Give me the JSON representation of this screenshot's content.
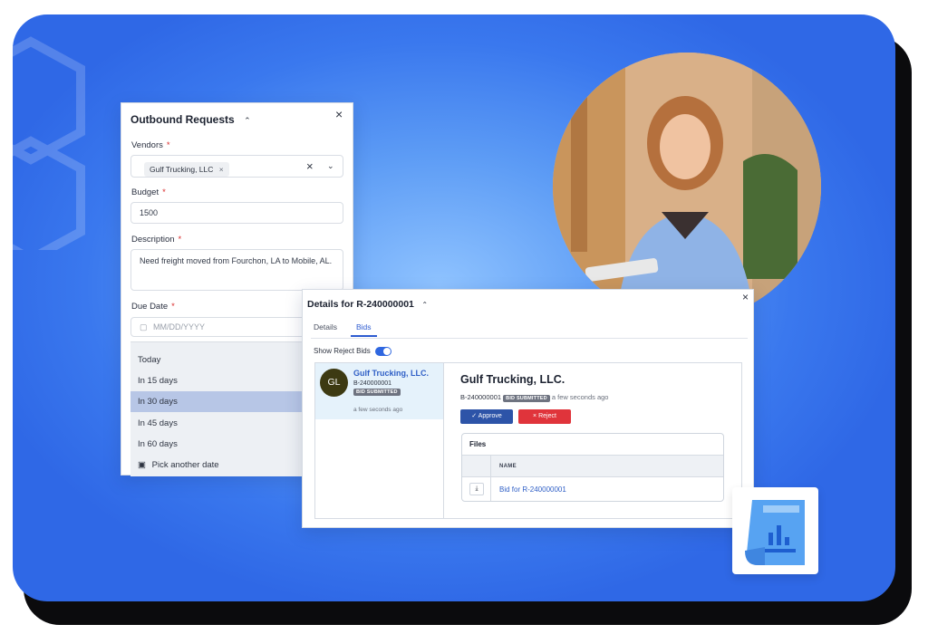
{
  "outbound": {
    "title": "Outbound Requests",
    "vendors_label": "Vendors",
    "vendor_chip": "Gulf Trucking, LLC",
    "budget_label": "Budget",
    "budget_value": "1500",
    "description_label": "Description",
    "description_value": "Need freight moved from Fourchon, LA to Mobile, AL.",
    "due_label": "Due Date",
    "due_placeholder": "MM/DD/YYYY",
    "options": [
      "Today",
      "In 15 days",
      "In 30 days",
      "In 45 days",
      "In 60 days",
      "Pick another date"
    ],
    "selected_option": "In 30 days"
  },
  "details": {
    "title": "Details for R-240000001",
    "tabs": [
      "Details",
      "Bids"
    ],
    "active_tab": "Bids",
    "toggle_label": "Show Reject Bids",
    "bid": {
      "initials": "GL",
      "vendor": "Gulf Trucking, LLC.",
      "id": "B-240000001",
      "status": "BID SUBMITTED",
      "time": "a few seconds ago"
    },
    "pane": {
      "vendor": "Gulf Trucking, LLC.",
      "id": "B-240000001",
      "status": "BID SUBMITTED",
      "time": "a few seconds ago",
      "approve": "Approve",
      "reject": "Reject",
      "files_title": "Files",
      "col_name": "NAME",
      "file_name": "Bid for R-240000001"
    }
  },
  "colors": {
    "accent": "#2f67e0",
    "approve": "#2d54a8",
    "reject": "#e0343b",
    "background": "#3a78ee"
  }
}
